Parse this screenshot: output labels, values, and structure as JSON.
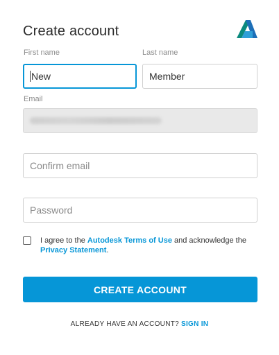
{
  "form": {
    "title": "Create account",
    "first_name": {
      "label": "First name",
      "value": "New"
    },
    "last_name": {
      "label": "Last name",
      "value": "Member"
    },
    "email": {
      "label": "Email"
    },
    "confirm_email": {
      "placeholder": "Confirm email"
    },
    "password": {
      "placeholder": "Password"
    }
  },
  "agreement": {
    "text_1": "I agree to the ",
    "terms_link": "Autodesk Terms of Use",
    "text_2": " and acknowledge the ",
    "privacy_link": "Privacy Statement",
    "text_3": "."
  },
  "buttons": {
    "create_account": "CREATE ACCOUNT"
  },
  "footer": {
    "have_account": "ALREADY HAVE AN ACCOUNT?",
    "sign_in": "SIGN IN"
  },
  "colors": {
    "accent": "#0696d7"
  },
  "icons": {
    "logo": "autodesk-logo-icon"
  }
}
